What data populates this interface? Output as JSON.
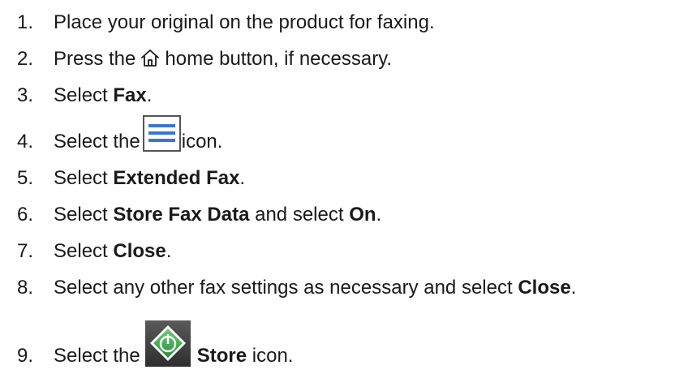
{
  "steps": [
    {
      "number": "1.",
      "parts": [
        "Place your original on the product for faxing."
      ]
    },
    {
      "number": "2.",
      "before": "Press the",
      "after": "home button, if necessary.",
      "icon": "home-icon"
    },
    {
      "number": "3.",
      "before": "Select ",
      "bold": "Fax",
      "after": "."
    },
    {
      "number": "4.",
      "before": "Select the",
      "after": "icon.",
      "icon": "menu-icon"
    },
    {
      "number": "5.",
      "before": "Select ",
      "bold": "Extended Fax",
      "after": "."
    },
    {
      "number": "6.",
      "before": "Select ",
      "bold": "Store Fax Data",
      "mid": " and select ",
      "bold2": "On",
      "after": "."
    },
    {
      "number": "7.",
      "before": "Select ",
      "bold": "Close",
      "after": "."
    },
    {
      "number": "8.",
      "before": "Select any other fax settings as necessary and select ",
      "bold": "Close",
      "after": "."
    },
    {
      "number": "9.",
      "before": "Select the",
      "bold": "Store",
      "after": " icon.",
      "icon": "start-icon"
    }
  ],
  "colors": {
    "text": "#1a1a1a",
    "menu_icon_blue": "#3a78c8",
    "start_icon_green": "#2f7a3d"
  }
}
